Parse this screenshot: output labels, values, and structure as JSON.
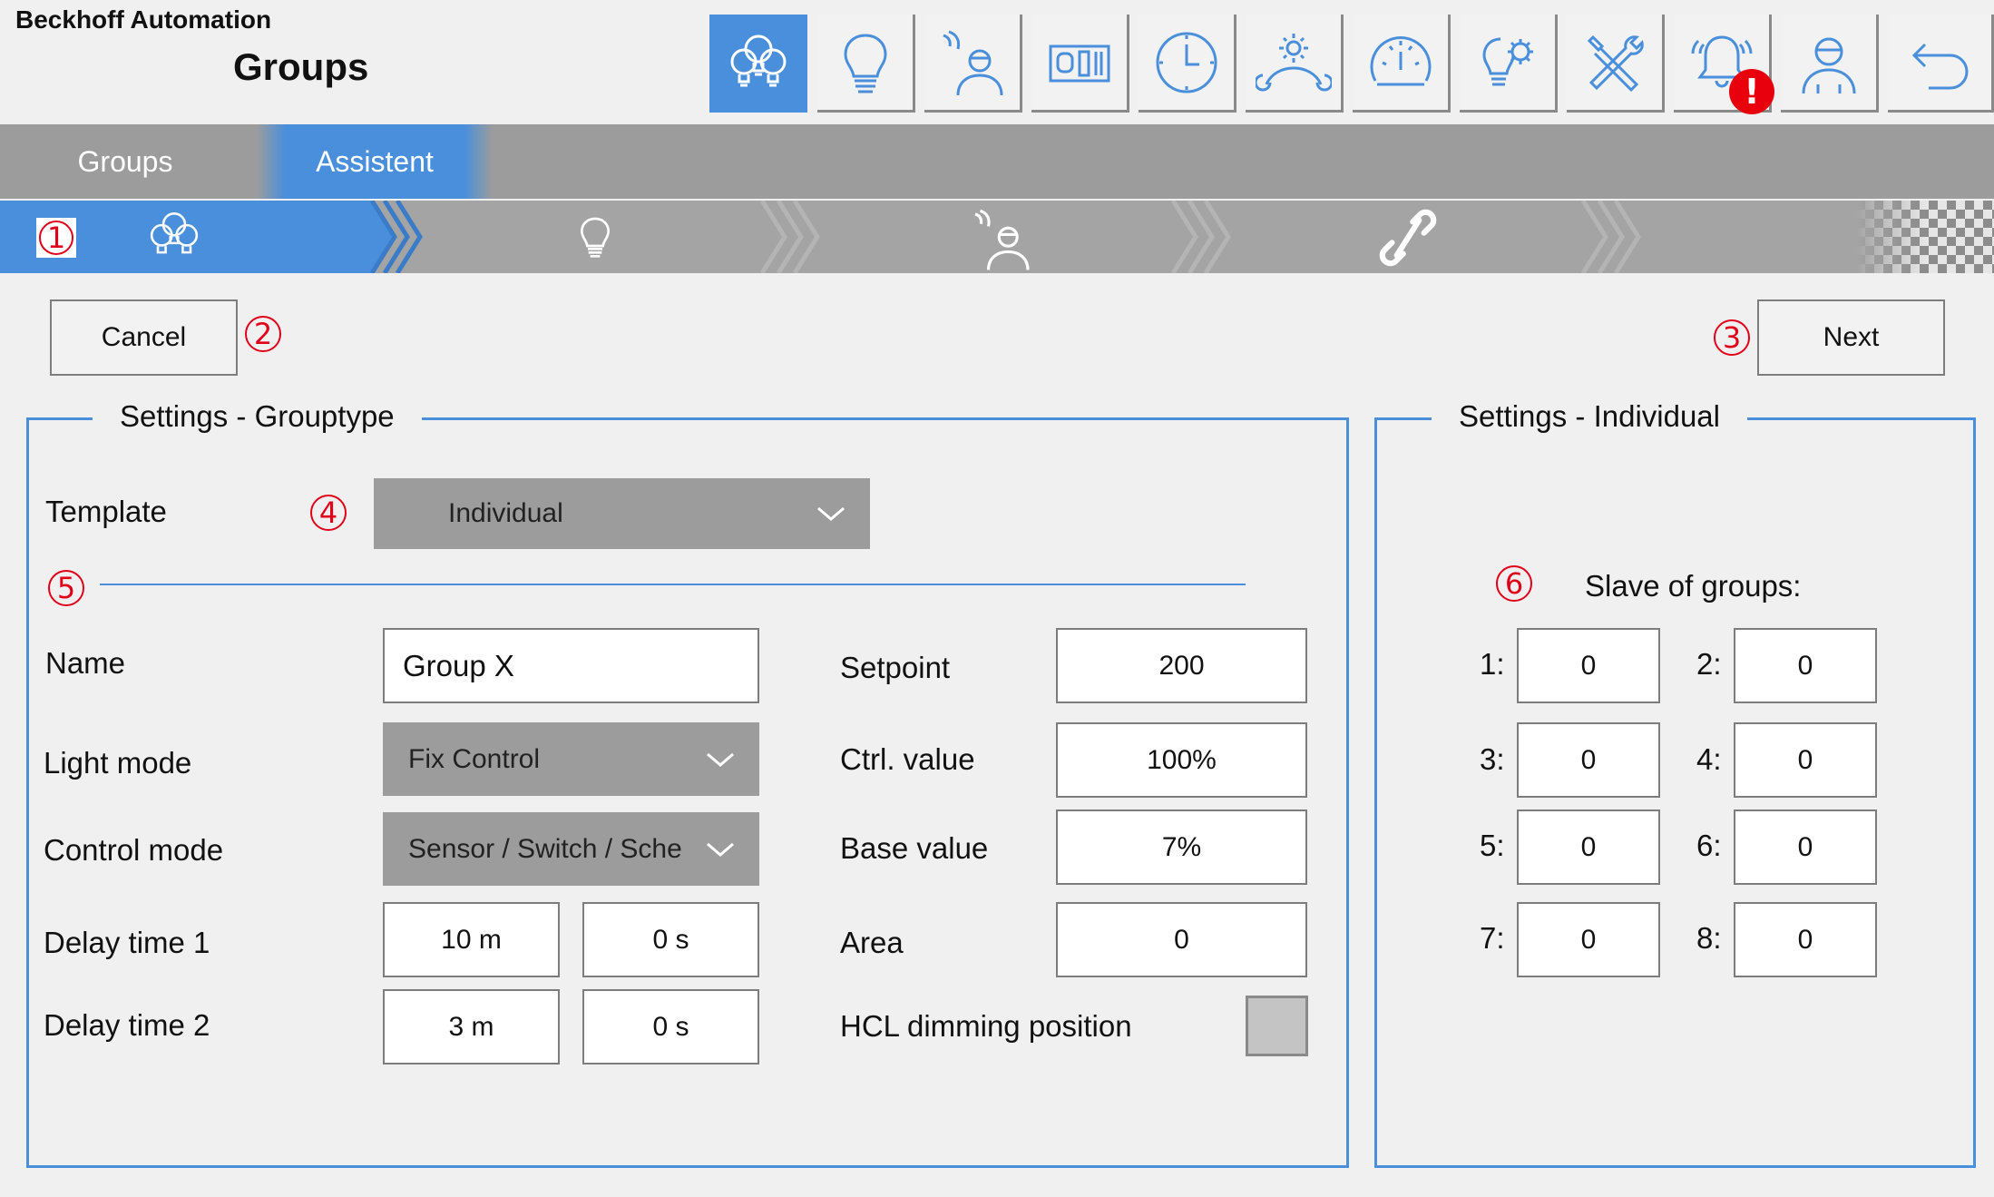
{
  "header": {
    "brand": "Beckhoff Automation",
    "title": "Groups",
    "buttons": [
      {
        "icon": "groups-bulbs-icon",
        "active": true
      },
      {
        "icon": "bulb-icon"
      },
      {
        "icon": "presence-sensor-icon"
      },
      {
        "icon": "switch-panel-icon"
      },
      {
        "icon": "clock-icon"
      },
      {
        "icon": "daylight-icon"
      },
      {
        "icon": "gauge-icon"
      },
      {
        "icon": "bulb-gear-icon"
      },
      {
        "icon": "tools-icon"
      },
      {
        "icon": "alarm-bell-icon",
        "badge": "!"
      },
      {
        "icon": "user-icon"
      },
      {
        "icon": "back-icon"
      }
    ]
  },
  "tabs": [
    {
      "label": "Groups",
      "active": false
    },
    {
      "label": "Assistent",
      "active": true
    }
  ],
  "steps": {
    "items": [
      "groups-bulbs-icon",
      "bulb-icon",
      "presence-sensor-icon",
      "link-icon",
      "finish-flag-icon"
    ],
    "active_index": 0
  },
  "markers": [
    "1",
    "2",
    "3",
    "4",
    "5",
    "6"
  ],
  "actions": {
    "cancel": "Cancel",
    "next": "Next"
  },
  "grouptype": {
    "legend": "Settings - Grouptype",
    "template_label": "Template",
    "template_value": "Individual",
    "name_label": "Name",
    "name_value": "Group X",
    "light_mode_label": "Light mode",
    "light_mode_value": "Fix Control",
    "control_mode_label": "Control mode",
    "control_mode_value": "Sensor / Switch / Sche",
    "delay1_label": "Delay time 1",
    "delay1_min": "10 m",
    "delay1_sec": "0 s",
    "delay2_label": "Delay time 2",
    "delay2_min": "3 m",
    "delay2_sec": "0 s",
    "setpoint_label": "Setpoint",
    "setpoint_value": "200",
    "ctrl_label": "Ctrl. value",
    "ctrl_value": "100%",
    "base_label": "Base value",
    "base_value": "7%",
    "area_label": "Area",
    "area_value": "0",
    "hcl_label": "HCL dimming position",
    "hcl_checked": false
  },
  "individual": {
    "legend": "Settings - Individual",
    "slave_title": "Slave of groups:",
    "slaves": [
      {
        "label": "1:",
        "value": "0"
      },
      {
        "label": "2:",
        "value": "0"
      },
      {
        "label": "3:",
        "value": "0"
      },
      {
        "label": "4:",
        "value": "0"
      },
      {
        "label": "5:",
        "value": "0"
      },
      {
        "label": "6:",
        "value": "0"
      },
      {
        "label": "7:",
        "value": "0"
      },
      {
        "label": "8:",
        "value": "0"
      }
    ]
  },
  "colors": {
    "accent": "#4a8fdb",
    "bar": "#9c9c9c",
    "marker": "#e0001a",
    "badge": "#e8000d"
  }
}
